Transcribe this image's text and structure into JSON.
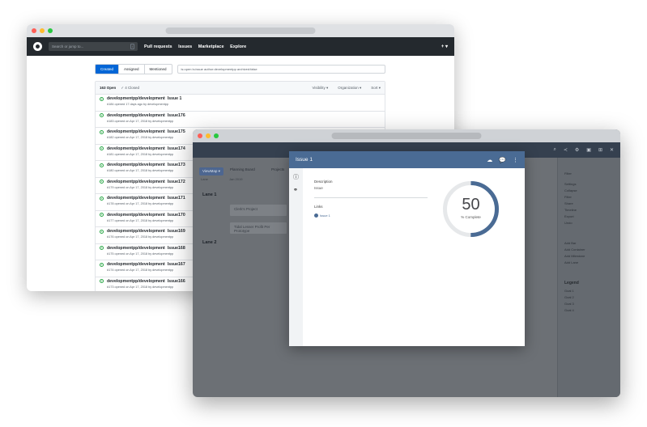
{
  "github": {
    "search_placeholder": "Search or jump to...",
    "search_kbd": "/",
    "nav": [
      "Pull requests",
      "Issues",
      "Marketplace",
      "Explore"
    ],
    "plus": "+ ▾",
    "tabs": [
      "Created",
      "Assigned",
      "Mentioned"
    ],
    "filter_query": "is:open is:issue author:developmentpp archived:false",
    "open_count": "163 Open",
    "closed_count": "✓ 4 Closed",
    "dropdowns": [
      "Visibility ▾",
      "Organization ▾",
      "Sort ▾"
    ],
    "issues": [
      {
        "repo": "developmentpp/development",
        "title": "Issue 1",
        "meta": "#184 opened 17 days ago by developmentpp"
      },
      {
        "repo": "developmentpp/development",
        "title": "Issue176",
        "meta": "#183 opened on Apr 17, 2018 by developmentpp"
      },
      {
        "repo": "developmentpp/development",
        "title": "Issue175",
        "meta": "#182 opened on Apr 17, 2018 by developmentpp"
      },
      {
        "repo": "developmentpp/development",
        "title": "Issue174",
        "meta": "#181 opened on Apr 17, 2018 by developmentpp"
      },
      {
        "repo": "developmentpp/development",
        "title": "Issue173",
        "meta": "#180 opened on Apr 17, 2018 by developmentpp"
      },
      {
        "repo": "developmentpp/development",
        "title": "Issue172",
        "meta": "#179 opened on Apr 17, 2018 by developmentpp"
      },
      {
        "repo": "developmentpp/development",
        "title": "Issue171",
        "meta": "#178 opened on Apr 17, 2018 by developmentpp"
      },
      {
        "repo": "developmentpp/development",
        "title": "Issue170",
        "meta": "#177 opened on Apr 17, 2018 by developmentpp"
      },
      {
        "repo": "developmentpp/development",
        "title": "Issue169",
        "meta": "#176 opened on Apr 17, 2018 by developmentpp"
      },
      {
        "repo": "developmentpp/development",
        "title": "Issue168",
        "meta": "#175 opened on Apr 17, 2018 by developmentpp"
      },
      {
        "repo": "developmentpp/development",
        "title": "Issue167",
        "meta": "#174 opened on Apr 17, 2018 by developmentpp"
      },
      {
        "repo": "developmentpp/development",
        "title": "Issue166",
        "meta": "#173 opened on Apr 17, 2018 by developmentpp"
      }
    ]
  },
  "planner": {
    "header_icons": [
      "⌕",
      "≺",
      "⚙",
      "▣",
      "⊞",
      "✕"
    ],
    "toolbar": {
      "view_button": "ViewMap ▾",
      "planning_board": "Planning Board",
      "projects": "Projects"
    },
    "columns": [
      "Lane",
      "Jan 2019"
    ],
    "lanes": [
      "Lane 1",
      "Lane 2"
    ],
    "cards": [
      "Clerk's Project",
      "Tidal Lesser Profit Per Prototype"
    ],
    "right_panel": {
      "top_items": [
        "Filter"
      ],
      "items": [
        "Settings",
        "Collapse",
        "Filter",
        "Share",
        "Timeline",
        "Export",
        "Undo"
      ],
      "actions": [
        "Add Bar",
        "Add Container",
        "Add Milestone",
        "Add Lane"
      ],
      "legend_title": "Legend",
      "legend": [
        "Goal 1",
        "Goal 2",
        "Goal 3",
        "Goal 4"
      ]
    }
  },
  "modal": {
    "title": "Issue 1",
    "description_label": "Description",
    "description_value": "Issue",
    "links_label": "Links",
    "link_item": "Issue 1",
    "progress_value": 50,
    "progress_label": "% Complete"
  },
  "colors": {
    "github_header": "#24292e",
    "github_primary": "#0366d6",
    "open_issue_green": "#28a745",
    "modal_header": "#4a6b94",
    "donut_track": "#e6e8ea",
    "donut_fill": "#4a6b94"
  }
}
